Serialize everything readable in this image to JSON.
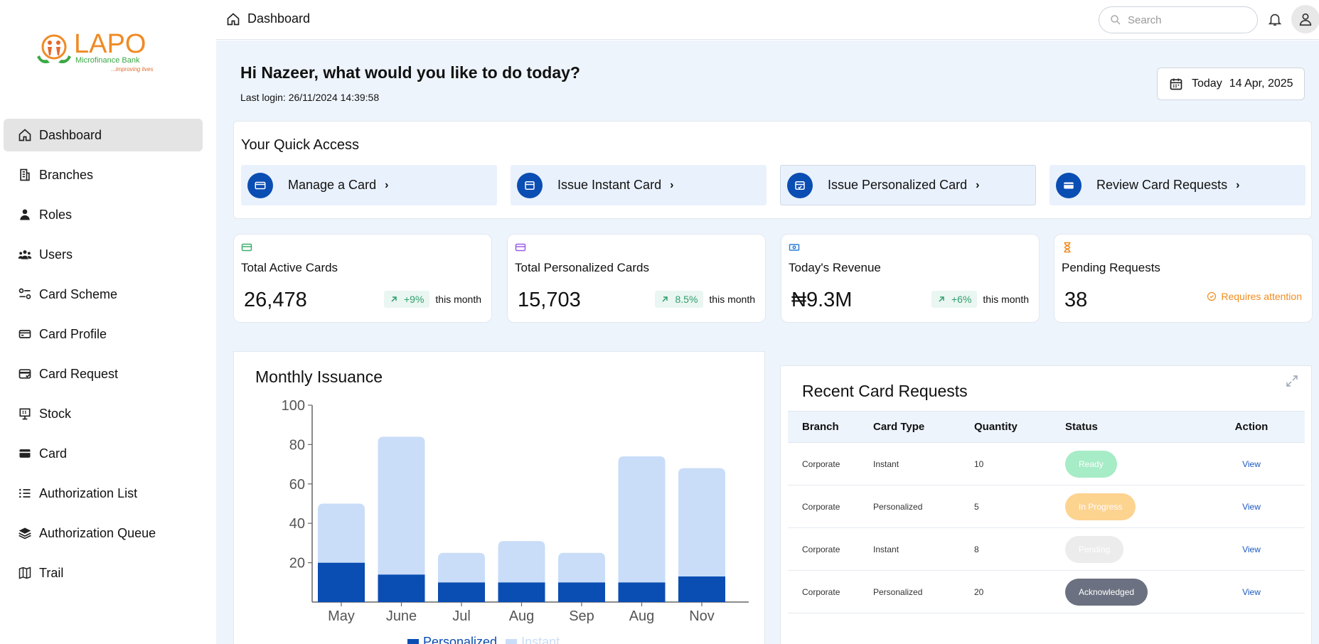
{
  "brand": {
    "logo_text": "LAPO",
    "logo_sub": "Microfinance Bank",
    "tagline": "...improving lives"
  },
  "sidebar": {
    "items": [
      {
        "label": "Dashboard",
        "icon": "home-icon",
        "active": true
      },
      {
        "label": "Branches",
        "icon": "building-icon"
      },
      {
        "label": "Roles",
        "icon": "person-icon"
      },
      {
        "label": "Users",
        "icon": "users-icon"
      },
      {
        "label": "Card Scheme",
        "icon": "scheme-icon"
      },
      {
        "label": "Card Profile",
        "icon": "card-outline-icon"
      },
      {
        "label": "Card Request",
        "icon": "card-request-icon"
      },
      {
        "label": "Stock",
        "icon": "stock-icon"
      },
      {
        "label": "Card",
        "icon": "card-filled-icon"
      },
      {
        "label": "Authorization List",
        "icon": "list-icon"
      },
      {
        "label": "Authorization Queue",
        "icon": "layers-icon"
      },
      {
        "label": "Trail",
        "icon": "map-icon"
      }
    ]
  },
  "header": {
    "breadcrumb": "Dashboard",
    "search_placeholder": "Search"
  },
  "greeting": {
    "title": "Hi Nazeer, what would you like to do today?",
    "last_login": "Last login: 26/11/2024 14:39:58"
  },
  "date": {
    "label": "Today",
    "value": "14 Apr, 2025"
  },
  "quick_access": {
    "title": "Your Quick Access",
    "items": [
      {
        "label": "Manage a Card"
      },
      {
        "label": "Issue Instant Card"
      },
      {
        "label": "Issue Personalized Card"
      },
      {
        "label": "Review Card Requests"
      }
    ]
  },
  "stats": [
    {
      "title": "Total Active Cards",
      "value": "26,478",
      "delta": "+9%",
      "suffix": "this month",
      "icon_color": "#3fae6d"
    },
    {
      "title": "Total Personalized Cards",
      "value": "15,703",
      "delta": "8.5%",
      "suffix": "this month",
      "icon_color": "#9b5de5"
    },
    {
      "title": "Today's Revenue",
      "value": "₦9.3M",
      "delta": "+6%",
      "suffix": "this month",
      "icon_color": "#2f7fd6"
    },
    {
      "title": "Pending Requests",
      "value": "38",
      "attention": "Requires attention",
      "icon_color": "#f28c1d"
    }
  ],
  "chart_title": "Monthly Issuance",
  "chart_data": {
    "type": "bar",
    "stacked": true,
    "categories": [
      "May",
      "June",
      "Jul",
      "Aug",
      "Sep",
      "Aug",
      "Nov"
    ],
    "series": [
      {
        "name": "Personalized",
        "values": [
          20,
          14,
          10,
          10,
          10,
          10,
          13
        ],
        "color": "#0a4db3"
      },
      {
        "name": "Instant",
        "values": [
          30,
          70,
          15,
          21,
          15,
          64,
          55
        ],
        "color": "#c9ddf8"
      }
    ],
    "ylim": [
      0,
      100
    ],
    "yticks": [
      20,
      40,
      60,
      80,
      100
    ],
    "legend": "bottom"
  },
  "recent": {
    "title": "Recent Card Requests",
    "columns": [
      "Branch",
      "Card Type",
      "Quantity",
      "Status",
      "Action"
    ],
    "rows": [
      {
        "branch": "Corporate",
        "type": "Instant",
        "qty": "10",
        "status": "Ready",
        "status_bg": "#a6ecc6",
        "action": "View"
      },
      {
        "branch": "Corporate",
        "type": "Personalized",
        "qty": "5",
        "status": "In Progress",
        "status_bg": "#fdd390",
        "action": "View"
      },
      {
        "branch": "Corporate",
        "type": "Instant",
        "qty": "8",
        "status": "Pending",
        "status_bg": "#ececec",
        "action": "View"
      },
      {
        "branch": "Corporate",
        "type": "Personalized",
        "qty": "20",
        "status": "Acknowledged",
        "status_bg": "#6b7180",
        "action": "View"
      }
    ]
  },
  "colors": {
    "primary": "#0a4db3",
    "main_bg": "#eef4fc",
    "success": "#2f9e6e",
    "warning": "#f28c1d"
  }
}
